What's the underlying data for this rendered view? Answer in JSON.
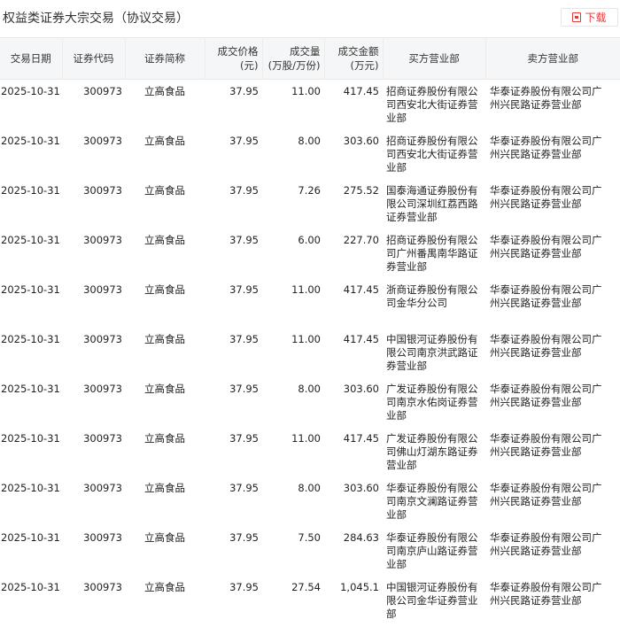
{
  "page": {
    "title": "权益类证券大宗交易（协议交易）",
    "download_label": "下载"
  },
  "table": {
    "headers": [
      "交易日期",
      "证券代码",
      "证券简称",
      "成交价格\n(元)",
      "成交量\n(万股/万份)",
      "成交金额\n(万元)",
      "买方营业部",
      "卖方营业部"
    ],
    "rows": [
      [
        "2025-10-31",
        "300973",
        "立高食品",
        "37.95",
        "11.00",
        "417.45",
        "招商证券股份有限公司西安北大街证券营业部",
        "华泰证券股份有限公司广州兴民路证券营业部"
      ],
      [
        "2025-10-31",
        "300973",
        "立高食品",
        "37.95",
        "8.00",
        "303.60",
        "招商证券股份有限公司西安北大街证券营业部",
        "华泰证券股份有限公司广州兴民路证券营业部"
      ],
      [
        "2025-10-31",
        "300973",
        "立高食品",
        "37.95",
        "7.26",
        "275.52",
        "国泰海通证券股份有限公司深圳红荔西路证券营业部",
        "华泰证券股份有限公司广州兴民路证券营业部"
      ],
      [
        "2025-10-31",
        "300973",
        "立高食品",
        "37.95",
        "6.00",
        "227.70",
        "招商证券股份有限公司广州番禺南华路证券营业部",
        "华泰证券股份有限公司广州兴民路证券营业部"
      ],
      [
        "2025-10-31",
        "300973",
        "立高食品",
        "37.95",
        "11.00",
        "417.45",
        "浙商证券股份有限公司金华分公司",
        "华泰证券股份有限公司广州兴民路证券营业部"
      ],
      [
        "2025-10-31",
        "300973",
        "立高食品",
        "37.95",
        "11.00",
        "417.45",
        "中国银河证券股份有限公司南京洪武路证券营业部",
        "华泰证券股份有限公司广州兴民路证券营业部"
      ],
      [
        "2025-10-31",
        "300973",
        "立高食品",
        "37.95",
        "8.00",
        "303.60",
        "广发证券股份有限公司南京水佑岗证券营业部",
        "华泰证券股份有限公司广州兴民路证券营业部"
      ],
      [
        "2025-10-31",
        "300973",
        "立高食品",
        "37.95",
        "11.00",
        "417.45",
        "广发证券股份有限公司佛山灯湖东路证券营业部",
        "华泰证券股份有限公司广州兴民路证券营业部"
      ],
      [
        "2025-10-31",
        "300973",
        "立高食品",
        "37.95",
        "8.00",
        "303.60",
        "华泰证券股份有限公司南京文澜路证券营业部",
        "华泰证券股份有限公司广州兴民路证券营业部"
      ],
      [
        "2025-10-31",
        "300973",
        "立高食品",
        "37.95",
        "7.50",
        "284.63",
        "华泰证券股份有限公司南京庐山路证券营业部",
        "华泰证券股份有限公司广州兴民路证券营业部"
      ],
      [
        "2025-10-31",
        "300973",
        "立高食品",
        "37.95",
        "27.54",
        "1,045.1",
        "中国银河证券股份有限公司金华证券营业部",
        "华泰证券股份有限公司广州兴民路证券营业部"
      ]
    ]
  }
}
